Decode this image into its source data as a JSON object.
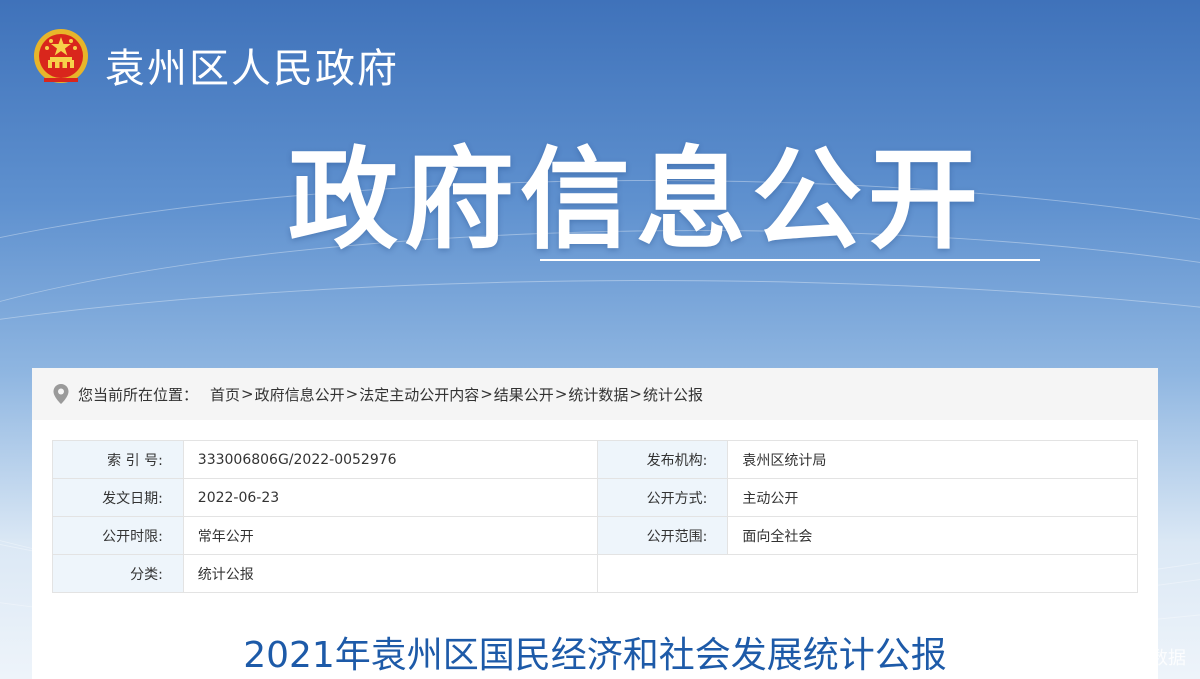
{
  "header": {
    "site_name": "袁州区人民政府",
    "emblem_icon": "national-emblem-icon"
  },
  "hero": {
    "title": "政府信息公开"
  },
  "breadcrumb": {
    "prefix": "您当前所在位置：",
    "items": [
      "首页",
      "政府信息公开",
      "法定主动公开内容",
      "结果公开",
      "统计数据",
      "统计公报"
    ],
    "separator": ">"
  },
  "meta": {
    "rows": [
      {
        "l1": "索 引 号:",
        "v1": "333006806G/2022-0052976",
        "l2": "发布机构:",
        "v2": "袁州区统计局"
      },
      {
        "l1": "发文日期:",
        "v1": "2022-06-23",
        "l2": "公开方式:",
        "v2": "主动公开"
      },
      {
        "l1": "公开时限:",
        "v1": "常年公开",
        "l2": "公开范围:",
        "v2": "面向全社会"
      },
      {
        "l1": "分类:",
        "v1": "统计公报",
        "l2": "",
        "v2": ""
      }
    ]
  },
  "document": {
    "title": "2021年袁州区国民经济和社会发展统计公报"
  },
  "overlay": {
    "corner_text": "数据"
  },
  "colors": {
    "title_blue": "#1d5aa8",
    "label_bg": "#eef5fb",
    "banner_top": "#3f72ba"
  }
}
